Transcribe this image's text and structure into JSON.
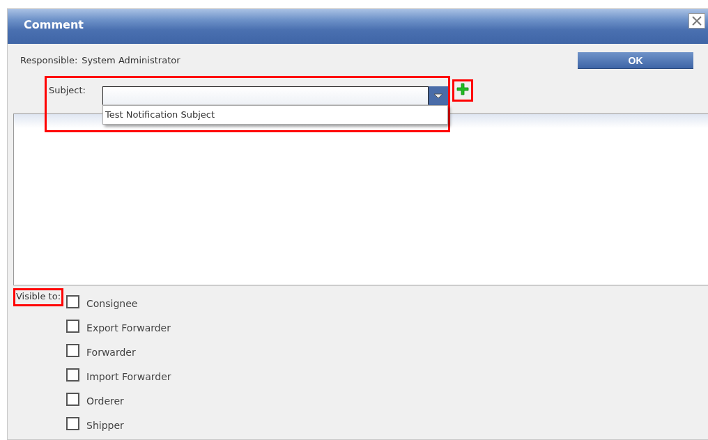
{
  "window": {
    "title": "Comment"
  },
  "responsible": {
    "label": "Responsible:",
    "value": "System Administrator"
  },
  "ok_button": {
    "label": "OK"
  },
  "subject": {
    "label": "Subject:",
    "highlighted": true,
    "options": [
      {
        "label": "Test Notification Subject",
        "selected": false
      }
    ]
  },
  "add_button": {
    "highlighted": true
  },
  "visible_to": {
    "label": "Visible to:",
    "highlighted": true,
    "options": [
      {
        "label": "Consignee",
        "checked": false
      },
      {
        "label": "Export Forwarder",
        "checked": false
      },
      {
        "label": "Forwarder",
        "checked": false
      },
      {
        "label": "Import Forwarder",
        "checked": false
      },
      {
        "label": "Orderer",
        "checked": false
      },
      {
        "label": "Shipper",
        "checked": false
      }
    ]
  }
}
